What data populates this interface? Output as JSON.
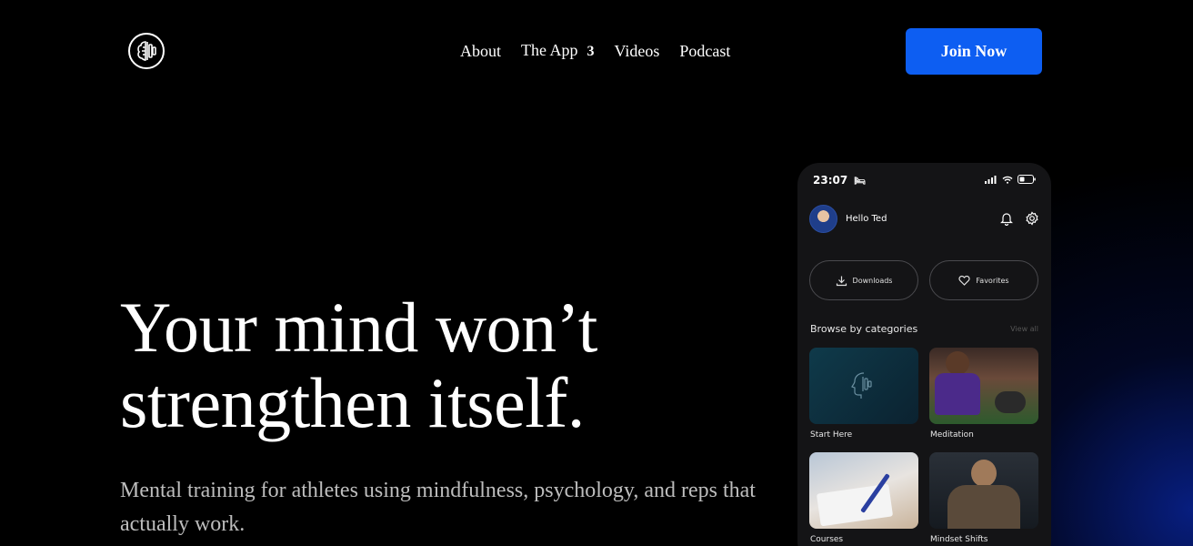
{
  "nav": {
    "items": [
      {
        "label": "About"
      },
      {
        "label": "The App",
        "badge": "3"
      },
      {
        "label": "Videos"
      },
      {
        "label": "Podcast"
      }
    ],
    "cta": "Join Now"
  },
  "hero": {
    "headline": "Your mind won’t strengthen itself.",
    "subtext": "Mental training for athletes using mindfulness, psychology, and reps that actually work."
  },
  "phone": {
    "time": "23:07",
    "greeting": "Hello Ted",
    "downloads": "Downloads",
    "favorites": "Favorites",
    "browse": "Browse by categories",
    "view_all": "View all",
    "categories": [
      {
        "label": "Start Here"
      },
      {
        "label": "Meditation"
      },
      {
        "label": "Courses"
      },
      {
        "label": "Mindset Shifts"
      }
    ]
  },
  "colors": {
    "accent": "#0d5ef2",
    "background": "#000000",
    "phone_bg": "#141416"
  }
}
